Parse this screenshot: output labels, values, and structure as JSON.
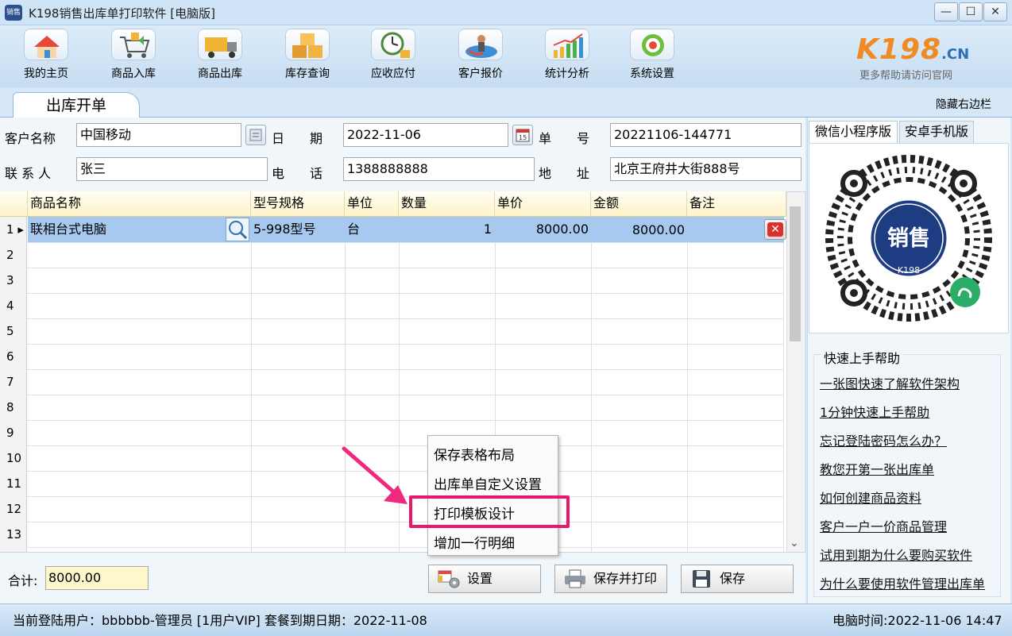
{
  "window": {
    "app_icon_text": "销售",
    "title": "K198销售出库单打印软件 [电脑版]",
    "minimize": "—",
    "maximize": "☐",
    "close": "✕"
  },
  "toolbar": {
    "items": [
      {
        "label": "我的主页",
        "icon": "home-icon"
      },
      {
        "label": "商品入库",
        "icon": "cart-icon"
      },
      {
        "label": "商品出库",
        "icon": "truck-icon"
      },
      {
        "label": "库存查询",
        "icon": "boxes-icon"
      },
      {
        "label": "应收应付",
        "icon": "clock-coins-icon"
      },
      {
        "label": "客户报价",
        "icon": "person-arrow-icon"
      },
      {
        "label": "统计分析",
        "icon": "bar-chart-icon"
      },
      {
        "label": "系统设置",
        "icon": "gear-icon"
      }
    ]
  },
  "logo": {
    "main": "K198",
    "domain": ".CN",
    "sub": "更多帮助请访问官网"
  },
  "tabs": {
    "active": "出库开单",
    "hide_right": "隐藏右边栏"
  },
  "form": {
    "customer_label": "客户名称",
    "customer_value": "中国移动",
    "date_label": "日　　期",
    "date_value": "2022-11-06",
    "number_label": "单　　号",
    "number_value": "20221106-144771",
    "contact_label": "联 系 人",
    "contact_value": "张三",
    "phone_label": "电　　话",
    "phone_value": "1388888888",
    "address_label": "地　　址",
    "address_value": "北京王府井大街888号"
  },
  "grid": {
    "columns": [
      "商品名称",
      "型号规格",
      "单位",
      "数量",
      "单价",
      "金额",
      "备注"
    ],
    "row": {
      "num": "1",
      "name": "联相台式电脑",
      "spec": "5-998型号",
      "unit": "台",
      "qty": "1",
      "price": "8000.00",
      "amount": "8000.00",
      "remark": ""
    },
    "row_numbers": [
      "2",
      "3",
      "4",
      "5",
      "6",
      "7",
      "8",
      "9",
      "10",
      "11",
      "12",
      "13"
    ],
    "scroll_down": "⌄"
  },
  "context_menu": {
    "items": [
      "保存表格布局",
      "出库单自定义设置",
      "打印模板设计",
      "增加一行明细"
    ],
    "highlight_color": "#e8186f"
  },
  "bottom": {
    "sum_label": "合计:",
    "sum_value": "8000.00",
    "settings_button": "设置",
    "save_print_button": "保存并打印",
    "save_button": "保存"
  },
  "status": {
    "left": "当前登陆用户：bbbbbb-管理员  [1用户VIP] 套餐到期日期：2022-11-08",
    "right": "电脑时间:2022-11-06 14:47"
  },
  "right_panel": {
    "tabs": [
      "微信小程序版",
      "安卓手机版"
    ],
    "qr_badge_text": "销售",
    "qr_badge_sub": "K198",
    "help_title": "快速上手帮助",
    "help_links": [
      "一张图快速了解软件架构",
      "1分钟快速上手帮助",
      "忘记登陆密码怎么办？",
      "教您开第一张出库单",
      "如何创建商品资料",
      "客户一户一价商品管理",
      "试用到期为什么要购买软件",
      "为什么要使用软件管理出库单"
    ]
  }
}
